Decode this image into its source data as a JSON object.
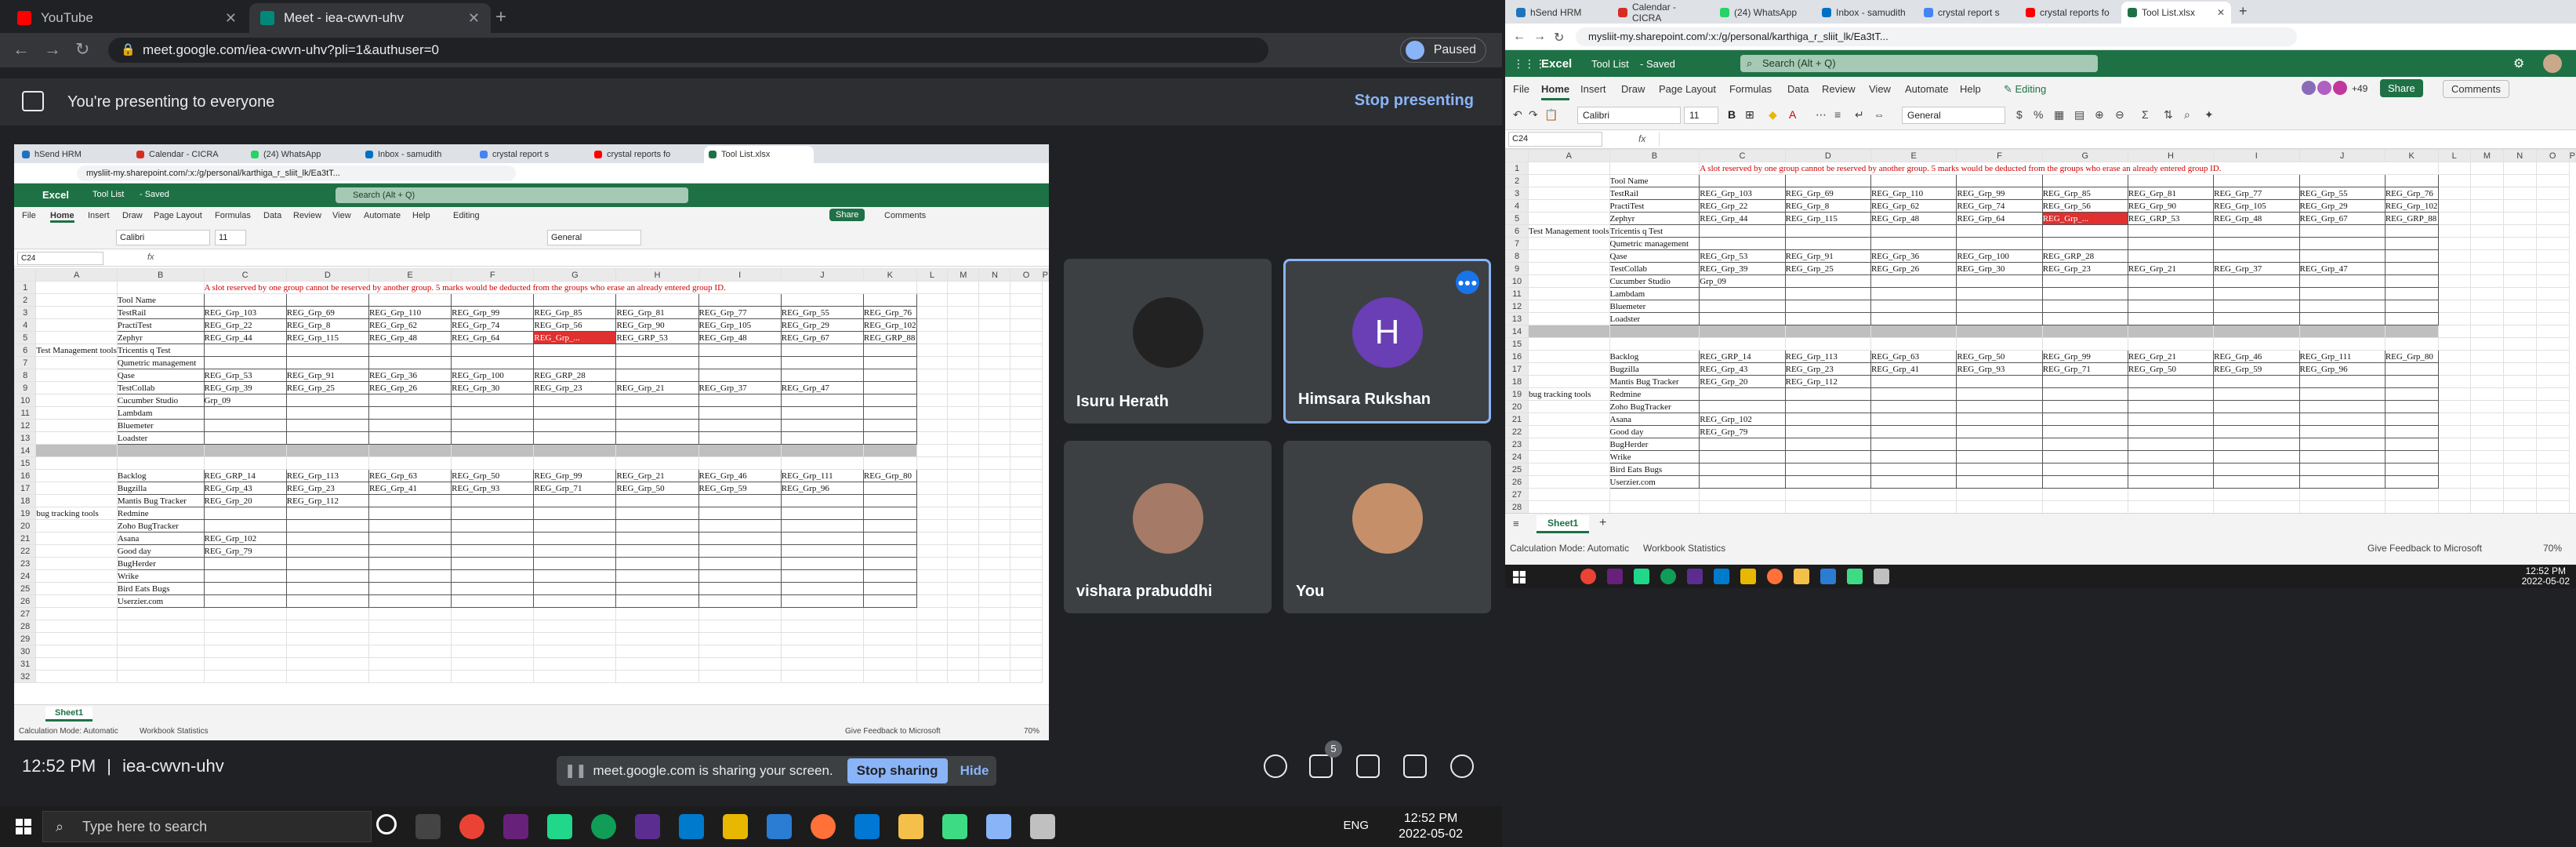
{
  "browser": {
    "tabs": [
      {
        "title": "YouTube",
        "color": "#ff0000"
      },
      {
        "title": "Meet - iea-cwvn-uhv",
        "color": "#00897b",
        "active": true
      }
    ],
    "url": "meet.google.com/iea-cwvn-uhv?pli=1&authuser=0",
    "paused_label": "Paused"
  },
  "meet": {
    "presenting_text": "You're presenting to everyone",
    "stop_presenting": "Stop presenting",
    "participants": [
      {
        "name": "Isuru Herath",
        "avatar_color": "#222222"
      },
      {
        "name": "Himsara Rukshan",
        "avatar_letter": "H",
        "avatar_color": "#6a3eb4"
      },
      {
        "name": "vishara prabuddhi",
        "avatar_color": "#a57a66"
      },
      {
        "name": "You",
        "avatar_color": "#c58f6a"
      }
    ],
    "time": "12:52 PM",
    "separator": "|",
    "meeting_code": "iea-cwvn-uhv",
    "sharing_text": "meet.google.com is sharing your screen.",
    "stop_sharing": "Stop sharing",
    "hide": "Hide",
    "people_count": "5"
  },
  "taskbar": {
    "search_placeholder": "Type here to search",
    "lang": "ENG",
    "time": "12:52 PM",
    "date": "2022-05-02"
  },
  "excel": {
    "tabs": [
      "hSend HRM",
      "Calendar - CICRA",
      "(24) WhatsApp",
      "Inbox - samudith",
      "crystal report s",
      "crystal reports fo",
      "Tool List.xlsx"
    ],
    "url": "mysliit-my.sharepoint.com/:x:/g/personal/karthiga_r_sliit_lk/Ea3tT...",
    "app_name": "Excel",
    "doc_name": "Tool List",
    "saved": "- Saved",
    "search_placeholder": "Search (Alt + Q)",
    "share": "Share",
    "comments": "Comments",
    "plus_count": "+49",
    "ribbon_tabs": [
      "File",
      "Home",
      "Insert",
      "Draw",
      "Page Layout",
      "Formulas",
      "Data",
      "Review",
      "View",
      "Automate",
      "Help"
    ],
    "editing": "Editing",
    "font": "Calibri",
    "font_size": "11",
    "number_format": "General",
    "name_box": "C24",
    "fx": "fx",
    "notice": "A slot reserved by one group cannot be reserved by another group. 5 marks would be deducted from the groups who erase an already entered group ID.",
    "columns": [
      "A",
      "B",
      "C",
      "D",
      "E",
      "F",
      "G",
      "H",
      "I",
      "J",
      "K",
      "L",
      "M",
      "N",
      "O",
      "P"
    ],
    "header_tool_name": "Tool Name",
    "section1_label": "Test Management tools",
    "section2_label": "bug tracking tools",
    "rows1": [
      {
        "tool": "TestRail",
        "cells": [
          "REG_Grp_103",
          "REG_Grp_69",
          "REG_Grp_110",
          "REG_Grp_99",
          "REG_Grp_85",
          "REG_Grp_81",
          "REG_Grp_77",
          "REG_Grp_55",
          "REG_Grp_76"
        ]
      },
      {
        "tool": "PractiTest",
        "cells": [
          "REG_Grp_22",
          "REG_Grp_8",
          "REG_Grp_62",
          "REG_Grp_74",
          "REG_Grp_56",
          "REG_Grp_90",
          "REG_Grp_105",
          "REG_Grp_29",
          "REG_Grp_102"
        ]
      },
      {
        "tool": "Zephyr",
        "cells": [
          "REG_Grp_44",
          "REG_Grp_115",
          "REG_Grp_48",
          "REG_Grp_64",
          "REG_Grp_...",
          "REG_GRP_53",
          "REG_Grp_48",
          "REG_Grp_67",
          "REG_GRP_88"
        ]
      },
      {
        "tool": "Tricentis q Test",
        "cells": []
      },
      {
        "tool": "Qumetric management",
        "cells": []
      },
      {
        "tool": "Qase",
        "cells": [
          "REG_Grp_53",
          "REG_Grp_91",
          "REG_Grp_36",
          "REG_Grp_100",
          "REG_GRP_28"
        ]
      },
      {
        "tool": "TestCollab",
        "cells": [
          "REG_Grp_39",
          "REG_Grp_25",
          "REG_Grp_26",
          "REG_Grp_30",
          "REG_Grp_23",
          "REG_Grp_21",
          "REG_Grp_37",
          "REG_Grp_47"
        ]
      },
      {
        "tool": "Cucumber Studio",
        "cells": [
          "Grp_09"
        ]
      },
      {
        "tool": "Lambdam",
        "cells": []
      },
      {
        "tool": "Bluemeter",
        "cells": []
      },
      {
        "tool": "Loadster",
        "cells": []
      }
    ],
    "rows2": [
      {
        "tool": "Backlog",
        "cells": [
          "REG_GRP_14",
          "REG_Grp_113",
          "REG_Grp_63",
          "REG_Grp_50",
          "REG_Grp_99",
          "REG_Grp_21",
          "REG_Grp_46",
          "REG_Grp_111",
          "REG_Grp_80"
        ]
      },
      {
        "tool": "Bugzilla",
        "cells": [
          "REG_Grp_43",
          "REG_Grp_23",
          "REG_Grp_41",
          "REG_Grp_93",
          "REG_Grp_71",
          "REG_Grp_50",
          "REG_Grp_59",
          "REG_Grp_96"
        ]
      },
      {
        "tool": "Mantis Bug Tracker",
        "cells": [
          "REG_Grp_20",
          "REG_Grp_112"
        ]
      },
      {
        "tool": "Redmine",
        "cells": []
      },
      {
        "tool": "Zoho BugTracker",
        "cells": []
      },
      {
        "tool": "Asana",
        "cells": [
          "REG_Grp_102"
        ]
      },
      {
        "tool": "Good day",
        "cells": [
          "REG_Grp_79"
        ]
      },
      {
        "tool": "BugHerder",
        "cells": []
      },
      {
        "tool": "Wrike",
        "cells": []
      },
      {
        "tool": "Bird Eats Bugs",
        "cells": []
      },
      {
        "tool": "Userzier.com",
        "cells": []
      }
    ],
    "sheet_tab": "Sheet1",
    "calc_mode": "Calculation Mode: Automatic",
    "workbook_stats": "Workbook Statistics",
    "feedback": "Give Feedback to Microsoft",
    "zoom": "70%",
    "r_time": "12:52 PM",
    "r_date": "2022-05-02"
  }
}
